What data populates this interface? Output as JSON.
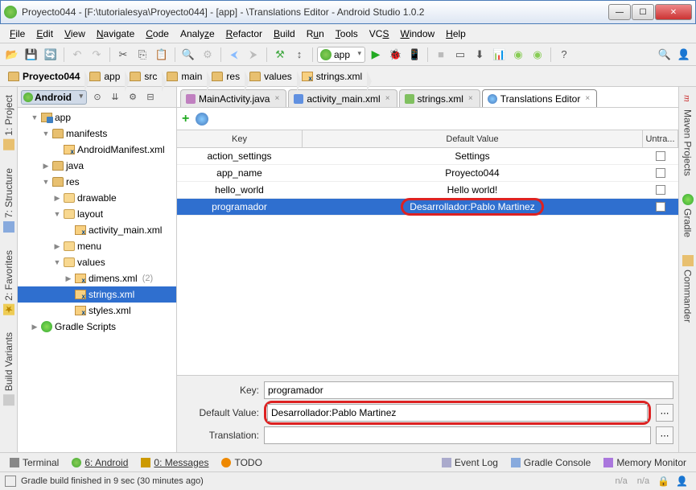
{
  "window": {
    "title": "Proyecto044 - [F:\\tutorialesya\\Proyecto044] - [app] - \\Translations Editor - Android Studio 1.0.2"
  },
  "menu": {
    "file": "File",
    "edit": "Edit",
    "view": "View",
    "navigate": "Navigate",
    "code": "Code",
    "analyze": "Analyze",
    "refactor": "Refactor",
    "build": "Build",
    "run": "Run",
    "tools": "Tools",
    "vcs": "VCS",
    "window": "Window",
    "help": "Help"
  },
  "toolbar": {
    "app_combo": "app"
  },
  "breadcrumb": [
    "Proyecto044",
    "app",
    "src",
    "main",
    "res",
    "values",
    "strings.xml"
  ],
  "left_tabs": {
    "project": "1: Project",
    "structure": "7: Structure",
    "favorites": "2: Favorites",
    "build_variants": "Build Variants"
  },
  "right_tabs": {
    "maven": "Maven Projects",
    "gradle": "Gradle",
    "commander": "Commander"
  },
  "project_combo": "Android",
  "tree": {
    "app": "app",
    "manifests": "manifests",
    "android_manifest": "AndroidManifest.xml",
    "java": "java",
    "res": "res",
    "drawable": "drawable",
    "layout": "layout",
    "activity_main": "activity_main.xml",
    "menu": "menu",
    "values": "values",
    "dimens": "dimens.xml",
    "dimens_count": "(2)",
    "strings": "strings.xml",
    "styles": "styles.xml",
    "gradle_scripts": "Gradle Scripts"
  },
  "tabs": {
    "main_activity": "MainActivity.java",
    "activity_main": "activity_main.xml",
    "strings": "strings.xml",
    "translations": "Translations Editor"
  },
  "table": {
    "h_key": "Key",
    "h_val": "Default Value",
    "h_un": "Untra...",
    "rows": [
      {
        "key": "action_settings",
        "val": "Settings"
      },
      {
        "key": "app_name",
        "val": "Proyecto044"
      },
      {
        "key": "hello_world",
        "val": "Hello world!"
      },
      {
        "key": "programador",
        "val": "Desarrollador:Pablo Martinez"
      }
    ]
  },
  "details": {
    "key_label": "Key:",
    "key_value": "programador",
    "default_label": "Default Value:",
    "default_value": "Desarrollador:Pablo Martinez",
    "translation_label": "Translation:",
    "translation_value": ""
  },
  "bottom": {
    "terminal": "Terminal",
    "android": "6: Android",
    "messages": "0: Messages",
    "todo": "TODO",
    "event_log": "Event Log",
    "gradle_console": "Gradle Console",
    "memory_monitor": "Memory Monitor"
  },
  "status": {
    "text": "Gradle build finished in 9 sec (30 minutes ago)",
    "na": "n/a"
  }
}
